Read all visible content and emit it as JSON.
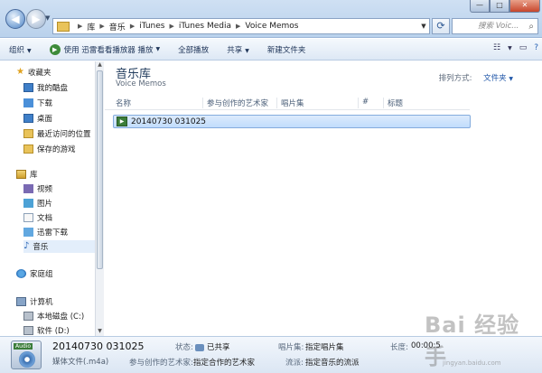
{
  "address": {
    "crumbs": [
      "库",
      "音乐",
      "iTunes",
      "iTunes Media",
      "Voice Memos"
    ],
    "search_placeholder": "搜索 Voic..."
  },
  "window": {
    "minimize": "—",
    "maximize": "□",
    "close": "✕"
  },
  "toolbar": {
    "organize": "组织",
    "play_with": "使用 迅雷看看播放器 播放",
    "play_all": "全部播放",
    "share": "共享",
    "new_folder": "新建文件夹"
  },
  "sidebar": {
    "favorites": {
      "label": "收藏夹",
      "items": [
        "我的酷盘",
        "下载",
        "桌面",
        "最近访问的位置",
        "保存的游戏"
      ]
    },
    "libraries": {
      "label": "库",
      "items": [
        "视频",
        "图片",
        "文档",
        "迅雷下载",
        "音乐"
      ],
      "selected": "音乐"
    },
    "homegroup": "家庭组",
    "computer": {
      "label": "计算机",
      "items": [
        "本地磁盘 (C:)",
        "软件 (D:)"
      ]
    }
  },
  "main": {
    "title": "音乐库",
    "subtitle": "Voice Memos",
    "arrange_label": "排列方式:",
    "arrange_value": "文件夹",
    "columns": [
      "名称",
      "参与创作的艺术家",
      "唱片集",
      "#",
      "标题"
    ],
    "files": [
      {
        "name": "20140730 031025",
        "icon": "audio-file-icon"
      }
    ]
  },
  "details": {
    "name": "20140730 031025",
    "type": "媒体文件(.m4a)",
    "icon_tag": "Audio",
    "status_label": "状态:",
    "status_value": "已共享",
    "artists_label": "参与创作的艺术家:",
    "artists_value": "指定合作的艺术家",
    "album_label": "唱片集:",
    "album_value": "指定唱片集",
    "genre_label": "流派:",
    "genre_value": "指定音乐的流派",
    "length_label": "长度:",
    "length_value": "00:00:5"
  },
  "watermark": {
    "text": "Bai 经验 手",
    "url": "jingyan.baidu.com"
  }
}
